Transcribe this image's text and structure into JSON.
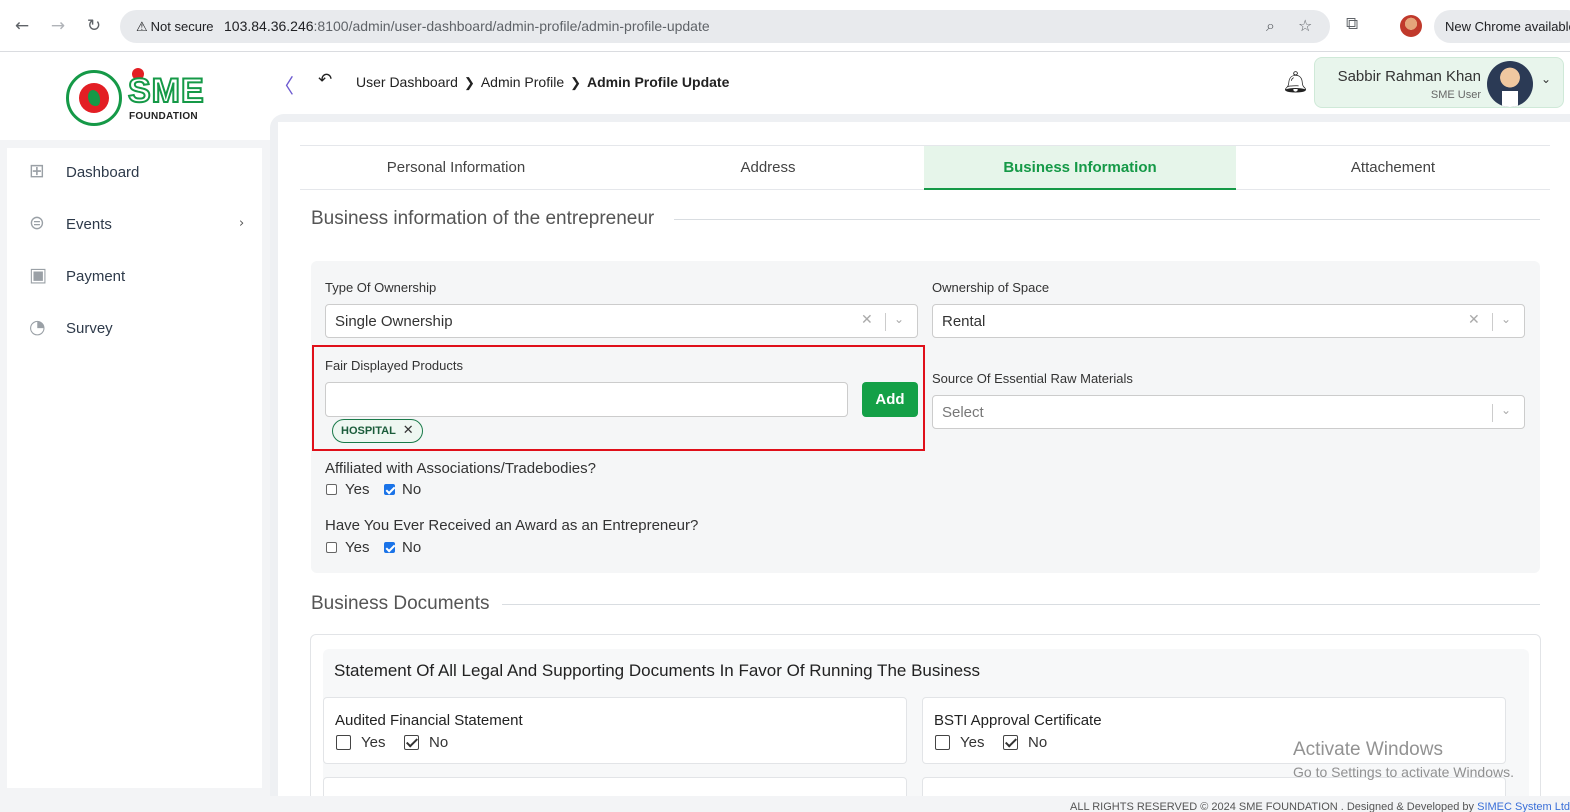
{
  "browser": {
    "not_secure": "Not secure",
    "url_host": "103.84.36.246",
    "url_rest": ":8100/admin/user-dashboard/admin-profile/admin-profile-update",
    "new_chrome": "New Chrome available",
    "icons": [
      "back-arrow",
      "forward-arrow",
      "reload",
      "warning",
      "zoom",
      "star",
      "extensions",
      "profile"
    ]
  },
  "header": {
    "logo_text": "SME",
    "logo_sub": "FOUNDATION",
    "breadcrumb": [
      "User Dashboard",
      "Admin Profile",
      "Admin Profile Update"
    ],
    "user_name": "Sabbir Rahman Khan",
    "user_role": "SME User"
  },
  "sidebar": {
    "items": [
      {
        "label": "Dashboard",
        "icon": "grid-icon"
      },
      {
        "label": "Events",
        "icon": "lock-circle-icon",
        "has_submenu": true
      },
      {
        "label": "Payment",
        "icon": "cash-icon"
      },
      {
        "label": "Survey",
        "icon": "pie-chart-icon"
      }
    ]
  },
  "tabs": [
    {
      "label": "Personal Information",
      "active": false
    },
    {
      "label": "Address",
      "active": false
    },
    {
      "label": "Business Information",
      "active": true
    },
    {
      "label": "Attachement",
      "active": false
    }
  ],
  "business_section": {
    "title": "Business information of the entrepreneur",
    "type_of_ownership": {
      "label": "Type Of Ownership",
      "value": "Single Ownership"
    },
    "ownership_of_space": {
      "label": "Ownership of Space",
      "value": "Rental"
    },
    "fair_products": {
      "label": "Fair Displayed Products",
      "input_value": "",
      "add_label": "Add",
      "chips": [
        "HOSPITAL"
      ]
    },
    "raw_materials": {
      "label": "Source Of Essential Raw Materials",
      "placeholder": "Select"
    },
    "affiliated": {
      "question": "Affiliated with Associations/Tradebodies?",
      "yes": "Yes",
      "no": "No",
      "yes_checked": false,
      "no_checked": true
    },
    "award": {
      "question": "Have You Ever Received an Award as an Entrepreneur?",
      "yes": "Yes",
      "no": "No",
      "yes_checked": false,
      "no_checked": true
    }
  },
  "documents_section": {
    "title": "Business Documents",
    "subtitle": "Statement Of All Legal And Supporting Documents In Favor Of Running The Business",
    "cards": [
      {
        "name": "Audited Financial Statement",
        "yes": "Yes",
        "no": "No",
        "no_checked": true
      },
      {
        "name": "BSTI Approval Certificate",
        "yes": "Yes",
        "no": "No",
        "no_checked": true
      }
    ]
  },
  "watermark": {
    "line1": "Activate Windows",
    "line2": "Go to Settings to activate Windows."
  },
  "footer": {
    "text": "ALL RIGHTS RESERVED © 2024 SME FOUNDATION . Designed & Developed by",
    "link": "SIMEC System Ltd."
  },
  "colors": {
    "brand_green": "#159947",
    "highlight_red": "#e0101a",
    "active_tab_bg": "#e6f5ea"
  }
}
